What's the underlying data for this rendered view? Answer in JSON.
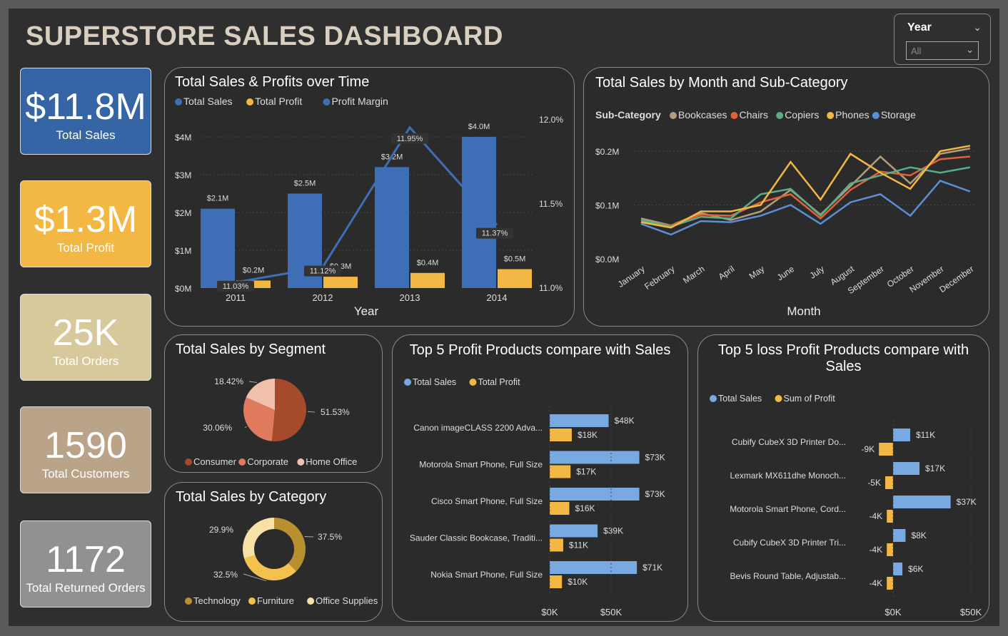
{
  "header": {
    "title": "SUPERSTORE SALES DASHBOARD"
  },
  "slicer": {
    "label": "Year",
    "value": "All"
  },
  "kpis": [
    {
      "value": "$11.8M",
      "label": "Total Sales",
      "color": "#3665a5"
    },
    {
      "value": "$1.3M",
      "label": "Total Profit",
      "color": "#f2b843"
    },
    {
      "value": "25K",
      "label": "Total Orders",
      "color": "#d8c99c"
    },
    {
      "value": "1590",
      "label": "Total Customers",
      "color": "#b9a48a"
    },
    {
      "value": "1172",
      "label": "Total Returned Orders",
      "color": "#919191"
    }
  ],
  "colors": {
    "sales": "#3e6fb6",
    "profit": "#f2b843",
    "margin": "#3e6fb6",
    "light_blue": "#78a9e0"
  },
  "chart_data": [
    {
      "type": "bar",
      "title": "Total Sales & Profits over Time",
      "xlabel": "Year",
      "categories": [
        "2011",
        "2012",
        "2013",
        "2014"
      ],
      "legend": [
        "Total Sales",
        "Total Profit",
        "Profit Margin"
      ],
      "series": [
        {
          "name": "Total Sales",
          "values": [
            2.1,
            2.5,
            3.2,
            4.0
          ],
          "labels": [
            "$2.1M",
            "$2.5M",
            "$3.2M",
            "$4.0M"
          ]
        },
        {
          "name": "Total Profit",
          "values": [
            0.2,
            0.3,
            0.4,
            0.5
          ],
          "labels": [
            "$0.2M",
            "$0.3M",
            "$0.4M",
            "$0.5M"
          ]
        },
        {
          "name": "Profit Margin",
          "axis": "right",
          "values": [
            11.03,
            11.12,
            11.95,
            11.37
          ],
          "labels": [
            "11.03%",
            "11.12%",
            "11.95%",
            "11.37%"
          ]
        }
      ],
      "yticks": [
        "$0M",
        "$1M",
        "$2M",
        "$3M",
        "$4M"
      ],
      "ylim": [
        0,
        4.0
      ],
      "y2ticks": [
        "11.0%",
        "11.5%",
        "12.0%"
      ],
      "y2lim": [
        11.0,
        12.0
      ]
    },
    {
      "type": "line",
      "title": "Total Sales by Month and Sub-Category",
      "xlabel": "Month",
      "legend_title": "Sub-Category",
      "categories": [
        "January",
        "February",
        "March",
        "April",
        "May",
        "June",
        "July",
        "August",
        "September",
        "October",
        "November",
        "December"
      ],
      "yticks": [
        "$0.0M",
        "$0.1M",
        "$0.2M"
      ],
      "ylim": [
        0,
        0.2
      ],
      "series": [
        {
          "name": "Bookcases",
          "color": "#b39c7c",
          "values": [
            0.075,
            0.062,
            0.085,
            0.072,
            0.088,
            0.128,
            0.082,
            0.135,
            0.19,
            0.14,
            0.195,
            0.205
          ]
        },
        {
          "name": "Chairs",
          "color": "#e0623b",
          "values": [
            0.07,
            0.062,
            0.082,
            0.08,
            0.105,
            0.12,
            0.075,
            0.128,
            0.162,
            0.155,
            0.185,
            0.19
          ]
        },
        {
          "name": "Copiers",
          "color": "#5aae86",
          "values": [
            0.072,
            0.06,
            0.078,
            0.075,
            0.12,
            0.13,
            0.08,
            0.14,
            0.155,
            0.17,
            0.16,
            0.17
          ]
        },
        {
          "name": "Phones",
          "color": "#f2b843",
          "values": [
            0.068,
            0.058,
            0.088,
            0.088,
            0.1,
            0.18,
            0.11,
            0.195,
            0.16,
            0.13,
            0.2,
            0.21
          ]
        },
        {
          "name": "Storage",
          "color": "#5b8fd6",
          "values": [
            0.065,
            0.045,
            0.07,
            0.068,
            0.08,
            0.1,
            0.065,
            0.105,
            0.12,
            0.08,
            0.145,
            0.125
          ]
        }
      ]
    },
    {
      "type": "pie",
      "title": "Total Sales by Segment",
      "slices": [
        {
          "name": "Consumer",
          "value": 51.53,
          "label": "51.53%",
          "color": "#a64a2c"
        },
        {
          "name": "Corporate",
          "value": 30.06,
          "label": "30.06%",
          "color": "#e07a5c"
        },
        {
          "name": "Home Office",
          "value": 18.42,
          "label": "18.42%",
          "color": "#f0c0ad"
        }
      ]
    },
    {
      "type": "pie",
      "title": "Total Sales by Category",
      "donut": true,
      "slices": [
        {
          "name": "Technology",
          "value": 37.5,
          "label": "37.5%",
          "color": "#b8902f"
        },
        {
          "name": "Furniture",
          "value": 32.5,
          "label": "32.5%",
          "color": "#f2c24c"
        },
        {
          "name": "Office Supplies",
          "value": 29.9,
          "label": "29.9%",
          "color": "#f8e1a6"
        }
      ]
    },
    {
      "type": "bar",
      "orientation": "horizontal",
      "title": "Top 5 Profit Products compare with Sales",
      "legend": [
        "Total Sales",
        "Total Profit"
      ],
      "categories": [
        "Canon imageCLASS 2200 Adva...",
        "Motorola Smart Phone, Full Size",
        "Cisco Smart Phone, Full Size",
        "Sauder Classic Bookcase, Traditi...",
        "Nokia Smart Phone, Full Size"
      ],
      "series": [
        {
          "name": "Total Sales",
          "values": [
            48,
            73,
            73,
            39,
            71
          ],
          "labels": [
            "$48K",
            "$73K",
            "$73K",
            "$39K",
            "$71K"
          ]
        },
        {
          "name": "Total Profit",
          "values": [
            18,
            17,
            16,
            11,
            10
          ],
          "labels": [
            "$18K",
            "$17K",
            "$16K",
            "$11K",
            "$10K"
          ]
        }
      ],
      "xticks": [
        "$0K",
        "$50K"
      ],
      "xlim": [
        0,
        100
      ]
    },
    {
      "type": "bar",
      "orientation": "horizontal",
      "title": "Top 5 loss Profit Products compare with Sales",
      "legend": [
        "Total Sales",
        "Sum of Profit"
      ],
      "categories": [
        "Cubify CubeX 3D Printer Do...",
        "Lexmark MX611dhe Monoch...",
        "Motorola Smart Phone, Cord...",
        "Cubify CubeX 3D Printer Tri...",
        "Bevis Round Table, Adjustab..."
      ],
      "series": [
        {
          "name": "Total Sales",
          "values": [
            11,
            17,
            37,
            8,
            6
          ],
          "labels": [
            "$11K",
            "$17K",
            "$37K",
            "$8K",
            "$6K"
          ]
        },
        {
          "name": "Sum of Profit",
          "values": [
            -9,
            -5,
            -4,
            -4,
            -4
          ],
          "labels": [
            "-9K",
            "-5K",
            "-4K",
            "-4K",
            "-4K"
          ]
        }
      ],
      "xticks": [
        "$0K",
        "$50K"
      ],
      "xlim": [
        0,
        50
      ]
    }
  ]
}
